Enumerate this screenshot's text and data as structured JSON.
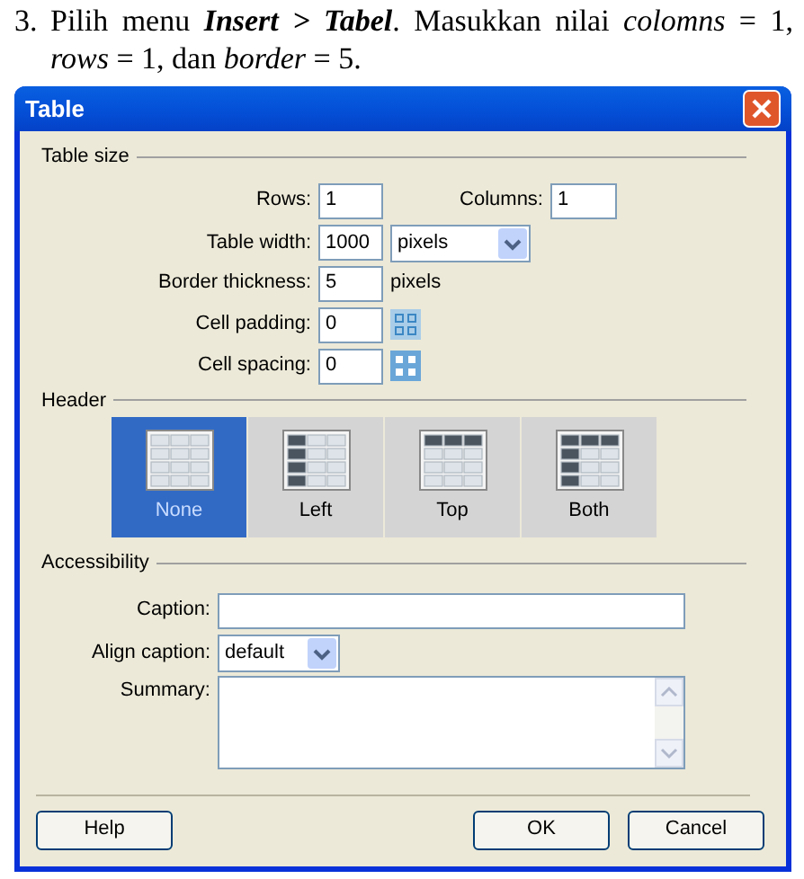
{
  "instruction": {
    "number": "3.",
    "text": "Pilih menu **Insert > Tabel**. Masukkan nilai *colomns* = 1, *rows* = 1, dan *border* = 5."
  },
  "window": {
    "title": "Table"
  },
  "table_size": {
    "legend": "Table size",
    "rows": {
      "label": "Rows:",
      "value": "1"
    },
    "columns": {
      "label": "Columns:",
      "value": "1"
    },
    "table_width": {
      "label": "Table width:",
      "value": "1000",
      "unit": "pixels"
    },
    "border_thickness": {
      "label": "Border thickness:",
      "value": "5",
      "unit": "pixels"
    },
    "cell_padding": {
      "label": "Cell padding:",
      "value": "0"
    },
    "cell_spacing": {
      "label": "Cell spacing:",
      "value": "0"
    }
  },
  "header": {
    "legend": "Header",
    "options": [
      {
        "label": "None",
        "kind": "none",
        "selected": true
      },
      {
        "label": "Left",
        "kind": "left",
        "selected": false
      },
      {
        "label": "Top",
        "kind": "top",
        "selected": false
      },
      {
        "label": "Both",
        "kind": "both",
        "selected": false
      }
    ]
  },
  "accessibility": {
    "legend": "Accessibility",
    "caption": {
      "label": "Caption:"
    },
    "align_caption": {
      "label": "Align caption:",
      "value": "default"
    },
    "summary": {
      "label": "Summary:"
    }
  },
  "buttons": [
    {
      "label": "Help",
      "kind": "help"
    },
    {
      "label": "OK",
      "kind": "ok"
    },
    {
      "label": "Cancel",
      "kind": "cancel"
    }
  ]
}
